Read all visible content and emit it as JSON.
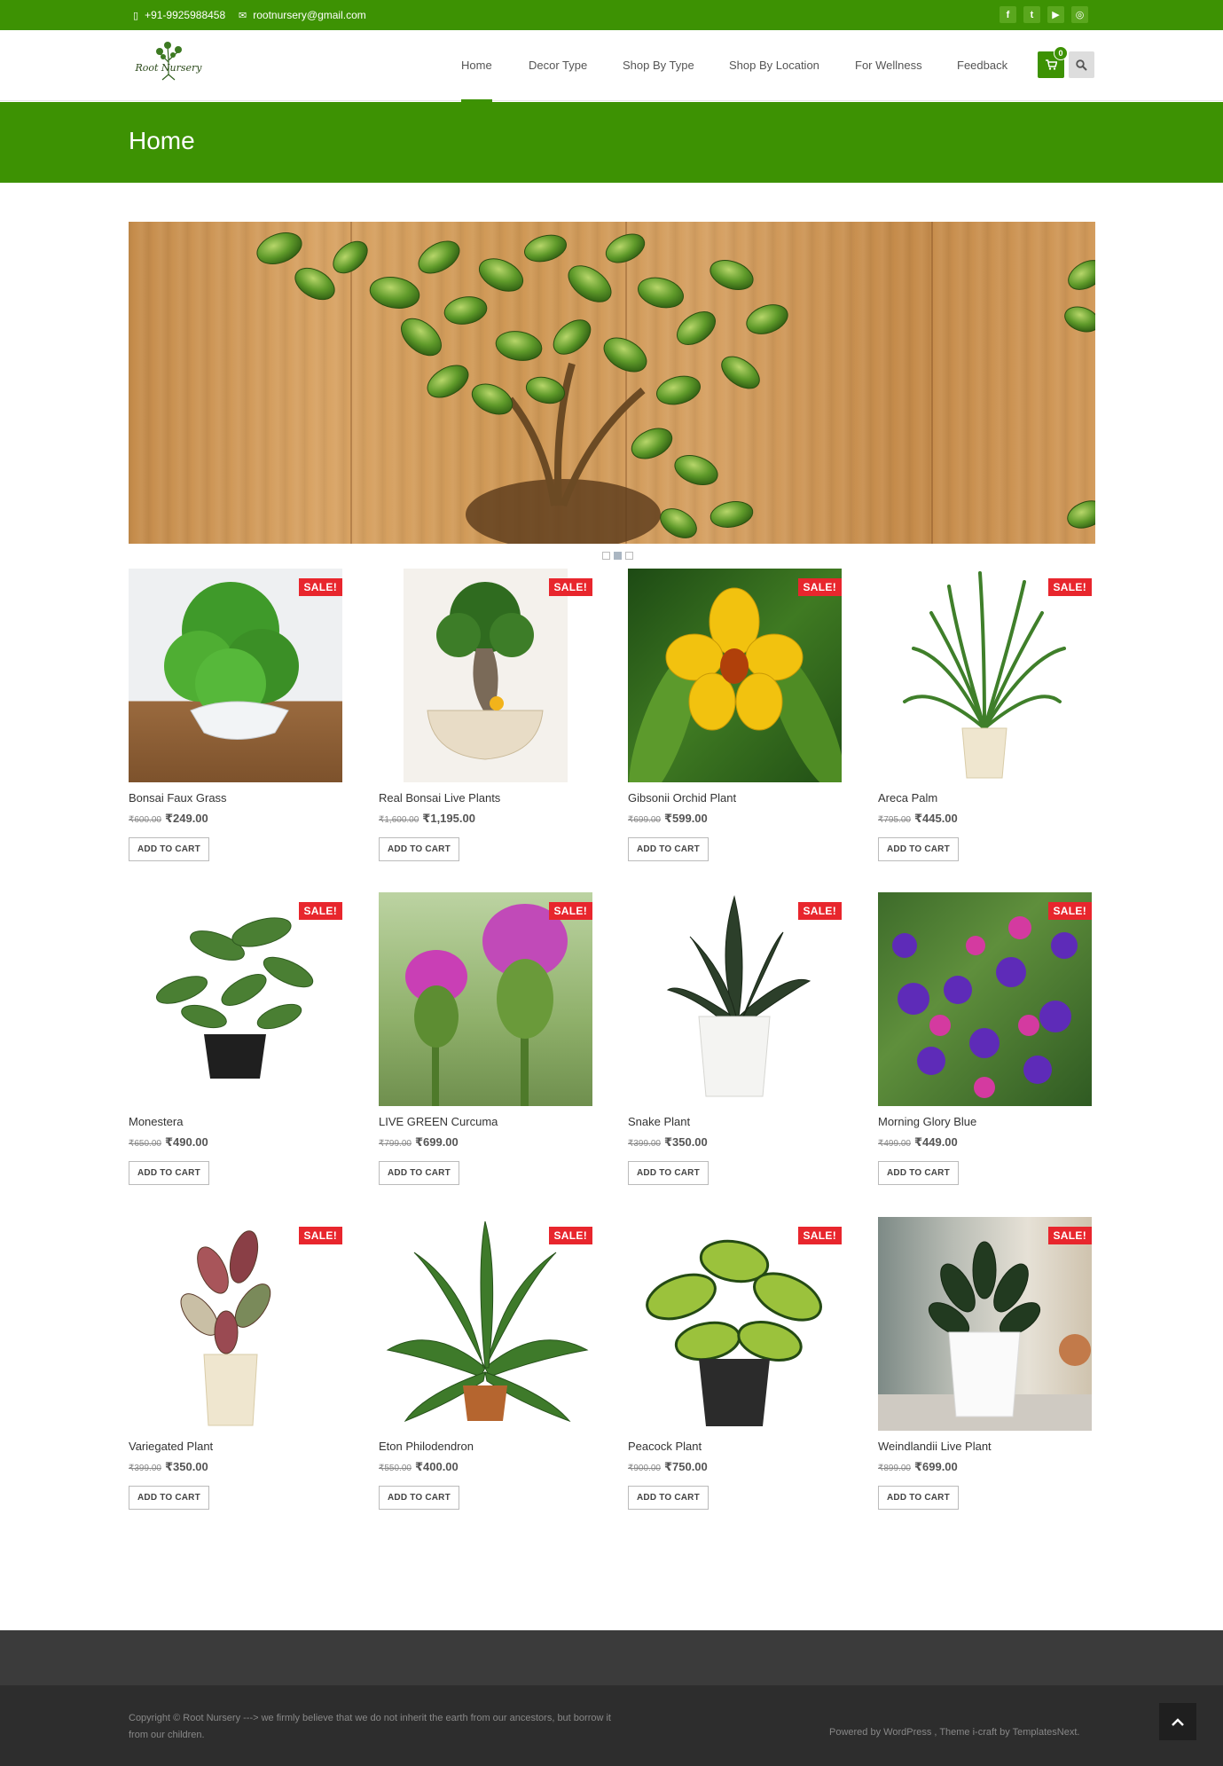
{
  "topbar": {
    "phone": "+91-9925988458",
    "email": "rootnursery@gmail.com",
    "social_icons": [
      "facebook-icon",
      "twitter-icon",
      "youtube-icon",
      "instagram-icon"
    ]
  },
  "header": {
    "logo_text": "Root Nursery",
    "nav": [
      "Home",
      "Decor Type",
      "Shop By Type",
      "Shop By Location",
      "For Wellness",
      "Feedback"
    ],
    "cart_count": "0"
  },
  "page_title": "Home",
  "sale_badge": "SALE!",
  "add_to_cart_label": "ADD TO CART",
  "products": [
    {
      "name": "Bonsai Faux Grass",
      "old_price": "₹600.00",
      "price": "₹249.00"
    },
    {
      "name": "Real Bonsai Live Plants",
      "old_price": "₹1,600.00",
      "price": "₹1,195.00"
    },
    {
      "name": "Gibsonii Orchid Plant",
      "old_price": "₹699.00",
      "price": "₹599.00"
    },
    {
      "name": "Areca Palm",
      "old_price": "₹795.00",
      "price": "₹445.00"
    },
    {
      "name": "Monestera",
      "old_price": "₹650.00",
      "price": "₹490.00"
    },
    {
      "name": "LIVE GREEN Curcuma",
      "old_price": "₹799.00",
      "price": "₹699.00"
    },
    {
      "name": "Snake Plant",
      "old_price": "₹399.00",
      "price": "₹350.00"
    },
    {
      "name": "Morning Glory Blue",
      "old_price": "₹499.00",
      "price": "₹449.00"
    },
    {
      "name": "Variegated Plant",
      "old_price": "₹399.00",
      "price": "₹350.00"
    },
    {
      "name": "Eton Philodendron",
      "old_price": "₹550.00",
      "price": "₹400.00"
    },
    {
      "name": "Peacock Plant",
      "old_price": "₹900.00",
      "price": "₹750.00"
    },
    {
      "name": "Weindlandii Live Plant",
      "old_price": "₹899.00",
      "price": "₹699.00"
    }
  ],
  "footer": {
    "copyright": "Copyright © Root Nursery ---> we firmly believe that we do not inherit the earth from our ancestors, but borrow it from our children.",
    "powered_by": "Powered by WordPress , Theme i-craft by TemplatesNext."
  },
  "colors": {
    "brand_green": "#3d9203",
    "sale_red": "#e8262d",
    "footer_dark": "#2d2d2d"
  }
}
